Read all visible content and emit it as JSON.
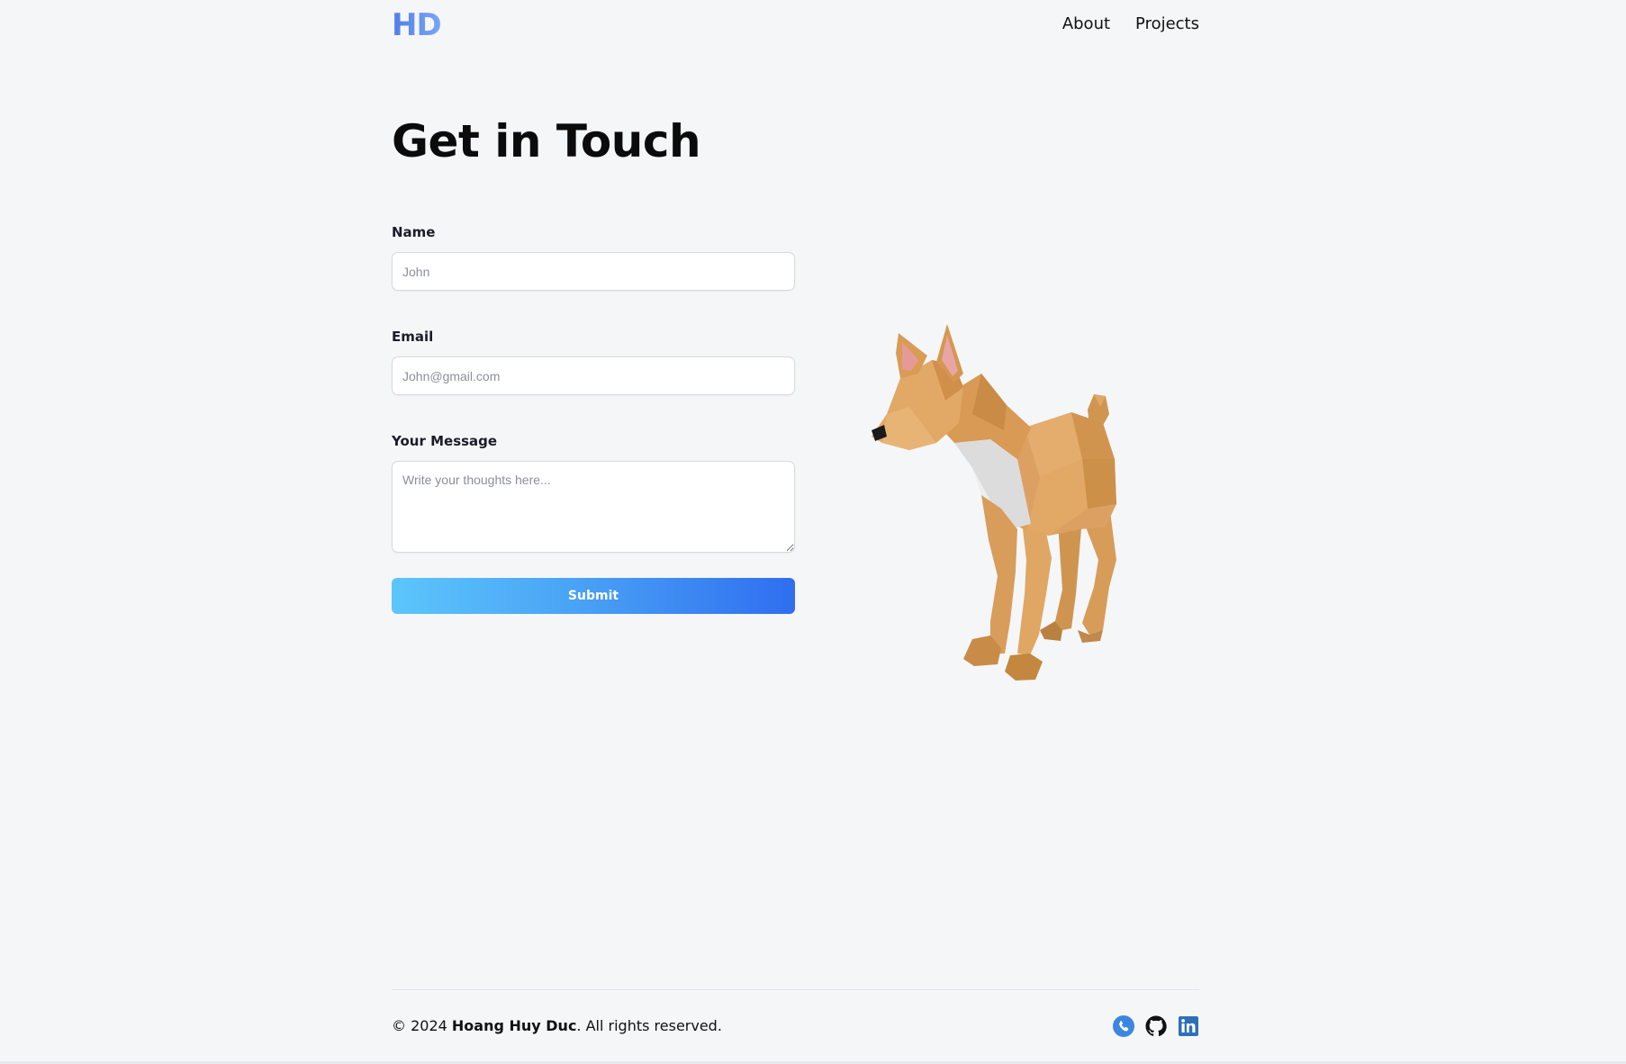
{
  "header": {
    "logo": "HD",
    "nav": [
      {
        "label": "About"
      },
      {
        "label": "Projects"
      }
    ]
  },
  "main": {
    "title": "Get in Touch",
    "form": {
      "name": {
        "label": "Name",
        "placeholder": "John",
        "value": ""
      },
      "email": {
        "label": "Email",
        "placeholder": "John@gmail.com",
        "value": ""
      },
      "message": {
        "label": "Your Message",
        "placeholder": "Write your thoughts here...",
        "value": ""
      },
      "submit_label": "Submit"
    },
    "illustration": "low-poly-fox-dog"
  },
  "footer": {
    "copyright_prefix": "© 2024 ",
    "owner": "Hoang Huy Duc",
    "copyright_suffix": ". All rights reserved.",
    "socials": [
      {
        "icon": "phone-icon"
      },
      {
        "icon": "github-icon"
      },
      {
        "icon": "linkedin-icon"
      }
    ]
  },
  "colors": {
    "background": "#f5f6f8",
    "accent_start": "#5cc6fb",
    "accent_end": "#2f6ef0",
    "logo": "#5b8def",
    "linkedin": "#2f6fb6"
  }
}
